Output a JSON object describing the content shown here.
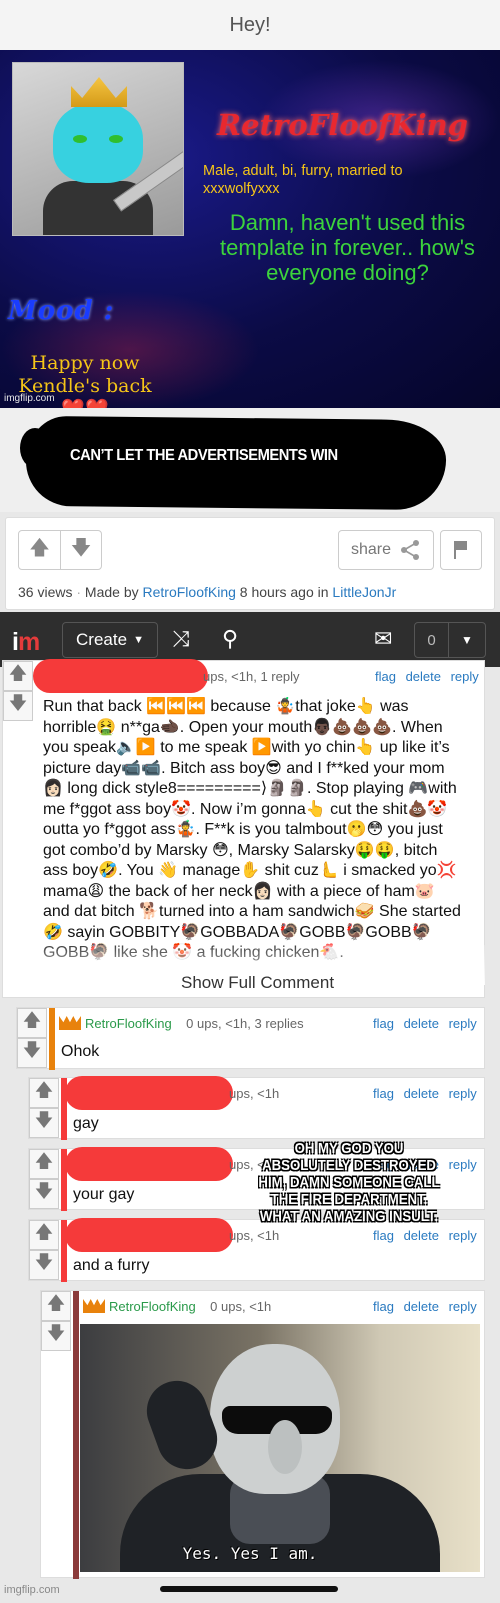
{
  "header": {
    "title": "Hey!"
  },
  "template": {
    "username": "RetroFloofKing",
    "bio": "Male, adult, bi, furry, married to xxxwolfyxxx",
    "greeting": "Damn, haven't used this template in forever.. how's everyone doing?",
    "mood_label": "Mood :",
    "mood_text": "Happy now Kendle's back",
    "mood_hearts": "❤️❤️",
    "watermark": "imgflip.com"
  },
  "banner": {
    "text": "CAN’T LET THE ADVERTISEMENTS WIN"
  },
  "meta": {
    "share_label": "share",
    "views": "36 views",
    "made_by_prefix": "Made by",
    "author": "RetroFloofKing",
    "time_prefix": "8 hours ago in",
    "stream": "LittleJonJr"
  },
  "nav": {
    "logo_i": "i",
    "logo_m": "m",
    "create_label": "Create",
    "notif_count": "0"
  },
  "comments": {
    "first": {
      "head": "ups, <1h, 1 reply",
      "actions": "flag delete reply",
      "text": "Run that back ⏮️⏮️⏮️ because 🤹that joke👆 was horrible🤮 n**ga🫲🏿. Open your mouth👨🏿💩💩💩. When you speak🔈▶️ to me speak ▶️with yo chin👆 up like it’s picture day📹📹. Bitch ass boy😎 and I f**ked your mom👩🏻 long dick style8=========⟩🗿🗿. Stop playing 🎮with me f*ggot ass boy🤡. Now i’m gonna👆 cut the shit💩🤡 outta yo f*ggot ass🤹. F**k is you talmbout🫢😳 you just got combo’d by Marsky 😳, Marsky Salarsky🤑🤑, bitch ass boy🤣. You 👋 manage✋ shit cuz🫷 i smacked yo💢 mama😩 the back of her neck👩🏻 with a piece of ham🐷 and dat bitch 🐕turned into a ham sandwich🥪 She started 🤣 sayin GOBBITY🦃GOBBADA🦃GOBB🦃GOBB🦃 GOBB🦃 like she 🤡 a fucking chicken🐔.",
      "show_full": "Show Full Comment"
    },
    "reply_ohok": {
      "user": "RetroFloofKing",
      "head": "0 ups, <1h, 3 replies",
      "actions": "flag delete reply",
      "text": "Ohok"
    },
    "reply_gay": {
      "head": "ups, <1h",
      "actions": "flag delete reply",
      "text": "gay"
    },
    "reply_your_gay": {
      "head": "ups, <1h",
      "actions": "flag delete reply",
      "text": "your gay"
    },
    "reply_furry": {
      "head": "ups, <1h",
      "actions": "flag delete reply",
      "text": "and a furry"
    },
    "reply_gru": {
      "user": "RetroFloofKing",
      "head": "0 ups, <1h",
      "actions": "flag delete reply",
      "subtitle": "Yes.  Yes I am."
    }
  },
  "overlay_caption": "OH MY GOD YOU ABSOLUTELY DESTROYED HIM, DAMN SOMEONE CALL THE FIRE DEPARTMENT. WHAT AN AMAZING INSULT.",
  "footer": {
    "watermark": "imgflip.com"
  }
}
